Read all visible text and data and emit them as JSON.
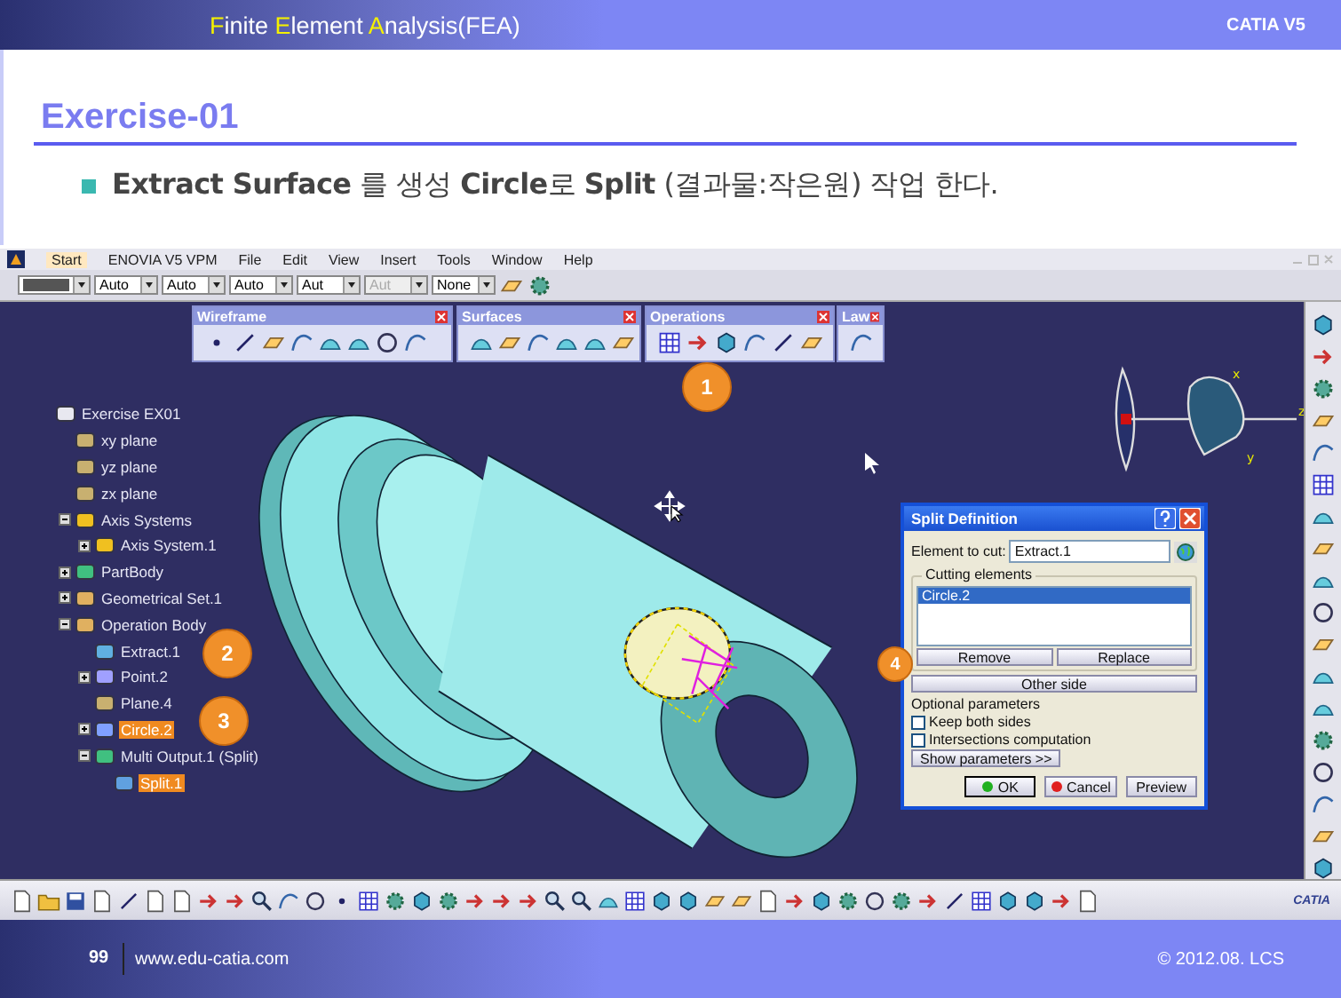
{
  "slide_header": {
    "title_segments": [
      {
        "text": "F",
        "highlight": true
      },
      {
        "text": "inite ",
        "highlight": false
      },
      {
        "text": "E",
        "highlight": true
      },
      {
        "text": "lement ",
        "highlight": false
      },
      {
        "text": "A",
        "highlight": true
      },
      {
        "text": "nalysis(FEA)",
        "highlight": false
      }
    ],
    "product": "CATIA V5"
  },
  "slide_title": "Exercise-01",
  "bullet": "**Extract Surface** 를 생성 **Circle**로 **Split** (결과물:작은원) 작업 한다.",
  "catia": {
    "menu": [
      {
        "label": "Start",
        "selected": true
      },
      {
        "label": "ENOVIA V5 VPM",
        "selected": false
      },
      {
        "label": "File",
        "selected": false
      },
      {
        "label": "Edit",
        "selected": false
      },
      {
        "label": "View",
        "selected": false
      },
      {
        "label": "Insert",
        "selected": false
      },
      {
        "label": "Tools",
        "selected": false
      },
      {
        "label": "Window",
        "selected": false
      },
      {
        "label": "Help",
        "selected": false
      }
    ],
    "dropdowns": [
      {
        "kind": "color",
        "disabled": false
      },
      {
        "kind": "text",
        "value": "Auto",
        "disabled": false
      },
      {
        "kind": "text",
        "value": "Auto",
        "disabled": false
      },
      {
        "kind": "text",
        "value": "Auto",
        "disabled": false
      },
      {
        "kind": "text",
        "value": "Aut",
        "disabled": false
      },
      {
        "kind": "text",
        "value": "Aut",
        "disabled": true
      },
      {
        "kind": "text",
        "value": "None",
        "disabled": false
      }
    ],
    "floating_toolbars": [
      "Wireframe",
      "Surfaces",
      "Operations",
      "Law"
    ],
    "tree": [
      {
        "label": "Exercise EX01",
        "kind": "document",
        "selected": false,
        "children": [
          {
            "label": "xy plane",
            "kind": "plane",
            "selected": false
          },
          {
            "label": "yz plane",
            "kind": "plane",
            "selected": false
          },
          {
            "label": "zx plane",
            "kind": "plane",
            "selected": false
          },
          {
            "label": "Axis Systems",
            "kind": "axis",
            "selected": false,
            "expanded": true,
            "children": [
              {
                "label": "Axis System.1",
                "kind": "axis",
                "selected": false,
                "expanded": false
              }
            ]
          },
          {
            "label": "PartBody",
            "kind": "body",
            "selected": false,
            "expanded": false
          },
          {
            "label": "Geometrical Set.1",
            "kind": "set",
            "selected": false,
            "expanded": false
          },
          {
            "label": "Operation Body",
            "kind": "set",
            "selected": false,
            "expanded": true,
            "children": [
              {
                "label": "Extract.1",
                "kind": "surface",
                "selected": false
              },
              {
                "label": "Point.2",
                "kind": "point",
                "selected": false,
                "expanded": false
              },
              {
                "label": "Plane.4",
                "kind": "plane",
                "selected": false
              },
              {
                "label": "Circle.2",
                "kind": "circle",
                "selected": true,
                "expanded": false
              },
              {
                "label": "Multi Output.1 (Split)",
                "kind": "body",
                "selected": false,
                "expanded": true,
                "children": [
                  {
                    "label": "Split.1",
                    "kind": "split",
                    "selected": true
                  }
                ]
              }
            ]
          }
        ]
      }
    ],
    "callouts": [
      "1",
      "2",
      "3",
      "4"
    ],
    "compass_labels": [
      "x",
      "y",
      "z"
    ],
    "dialog": {
      "title": "Split Definition",
      "element_label": "Element to cut:",
      "element_value": "Extract.1",
      "group_label": "Cutting elements",
      "list": [
        {
          "text": "Circle.2",
          "selected": true
        }
      ],
      "list_buttons": [
        "Remove",
        "Replace"
      ],
      "other_side": "Other side",
      "optional_label": "Optional parameters",
      "checkboxes": [
        {
          "label": "Keep both sides",
          "checked": false
        },
        {
          "label": "Intersections computation",
          "checked": false
        }
      ],
      "show_parameters": "Show parameters >>",
      "actions": [
        {
          "label": "OK",
          "kind": "ok"
        },
        {
          "label": "Cancel",
          "kind": "cancel"
        },
        {
          "label": "Preview",
          "kind": "plain"
        }
      ]
    },
    "logo_text": "CATIA"
  },
  "footer": {
    "page": "99",
    "url": "www.edu-catia.com",
    "copyright": "© 2012.08. LCS"
  }
}
